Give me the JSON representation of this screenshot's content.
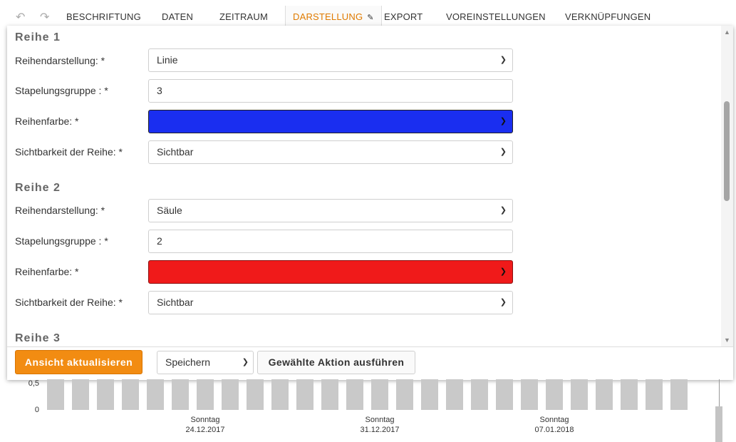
{
  "tabs": {
    "items": [
      {
        "label": "BESCHRIFTUNG"
      },
      {
        "label": "DATEN"
      },
      {
        "label": "ZEITRAUM"
      },
      {
        "label": "DARSTELLUNG",
        "active": true
      },
      {
        "label": "EXPORT"
      },
      {
        "label": "VOREINSTELLUNGEN"
      },
      {
        "label": "VERKNÜPFUNGEN"
      }
    ],
    "undo_icon": "undo-icon",
    "redo_icon": "redo-icon",
    "edit_icon": "pencil-icon"
  },
  "series": [
    {
      "title": "Reihe 1",
      "type_label": "Reihendarstellung: *",
      "type_value": "Linie",
      "stack_label": "Stapelungsgruppe : *",
      "stack_value": "3",
      "color_label": "Reihenfarbe: *",
      "color": "#1a2ef0",
      "visibility_label": "Sichtbarkeit der Reihe: *",
      "visibility_value": "Sichtbar"
    },
    {
      "title": "Reihe 2",
      "type_label": "Reihendarstellung: *",
      "type_value": "Säule",
      "stack_label": "Stapelungsgruppe : *",
      "stack_value": "2",
      "color_label": "Reihenfarbe: *",
      "color": "#f01a1a",
      "visibility_label": "Sichtbarkeit der Reihe: *",
      "visibility_value": "Sichtbar"
    },
    {
      "title": "Reihe 3"
    }
  ],
  "footer": {
    "update_label": "Ansicht aktualisieren",
    "action_value": "Speichern",
    "execute_label": "Gewählte Aktion ausführen"
  },
  "chart": {
    "y_ticks": [
      "0,5",
      "0"
    ],
    "x_labels": [
      {
        "day": "Sonntag",
        "date": "24.12.2017"
      },
      {
        "day": "Sonntag",
        "date": "31.12.2017"
      },
      {
        "day": "Sonntag",
        "date": "07.01.2018"
      }
    ],
    "bar_color": "#c9c9c9"
  },
  "colors": {
    "accent": "#f28c12",
    "active_tab": "#e07b00"
  }
}
